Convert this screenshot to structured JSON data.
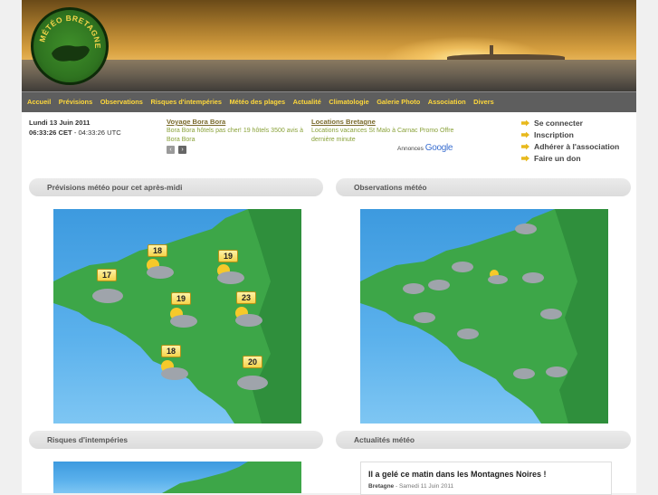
{
  "site": {
    "logo_text": "MÉTÉO BRETAGNE"
  },
  "nav": {
    "items": [
      "Accueil",
      "Prévisions",
      "Observations",
      "Risques d'intempéries",
      "Météo des plages",
      "Actualité",
      "Climatologie",
      "Galerie Photo",
      "Association",
      "Divers"
    ]
  },
  "date": {
    "day": "Lundi 13 Juin 2011",
    "time_cet": "06:33:26 CET",
    "time_utc": " - 04:33:26 UTC"
  },
  "ads": [
    {
      "title": "Voyage Bora Bora",
      "text": "Bora Bora hôtels pas cher! 19 hôtels 3500 avis à Bora Bora"
    },
    {
      "title": "Locations Bretagne",
      "text": "Locations vacances St Malo à Carnac Promo Offre dernière minute"
    }
  ],
  "ad_provider": {
    "label": "Annonces",
    "brand": "Google"
  },
  "user_links": [
    "Se connecter",
    "Inscription",
    "Adhérer à l'association",
    "Faire un don"
  ],
  "panels": {
    "forecast_title": "Prévisions météo pour cet après-midi",
    "observations_title": "Observations météo",
    "risks_title": "Risques d'intempéries",
    "news_title": "Actualités météo"
  },
  "forecast_temps": [
    "18",
    "19",
    "17",
    "19",
    "23",
    "18",
    "20"
  ],
  "news": {
    "headline": "Il a gelé ce matin dans les Montagnes Noires !",
    "region": "Bretagne",
    "date": " - Samedi 11 Juin 2011"
  },
  "colors": {
    "nav_bg": "#5e5e5e",
    "nav_text": "#ffd83b",
    "land": "#3fa64a",
    "sea": "#4aa6e6"
  }
}
